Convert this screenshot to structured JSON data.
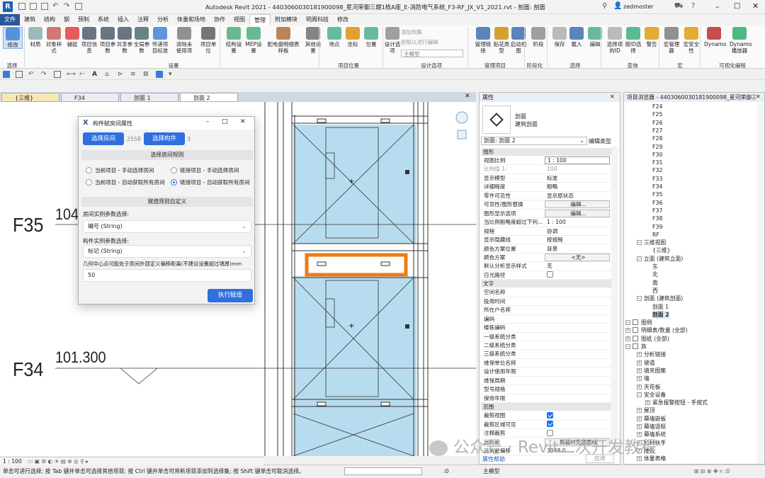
{
  "app": {
    "title": "Autodesk Revit 2021 - 4403060030181900098_星河荣御三期1栋A座_E-消防电气系统_F3-RF_JX_V1_2021.rvt - 剖面: 剖面 2",
    "user": "zedmoster",
    "logo_letter": "R"
  },
  "menu": [
    "文件",
    "建筑",
    "结构",
    "钢",
    "预制",
    "系统",
    "插入",
    "注释",
    "分析",
    "体量和场地",
    "协作",
    "视图",
    "管理",
    "附加模块",
    "明周科技",
    "修改"
  ],
  "ribbon": {
    "buttons": [
      "修改",
      "材质",
      "对象样式",
      "捕捉",
      "项目信息",
      "项目参数",
      "共享参数",
      "全局参数",
      "传递项目标准",
      "清除未使用项",
      "项目单位",
      "结构设置",
      "MEP设置",
      "配电盘明细表样板",
      "其他设置",
      "地点",
      "坐标",
      "位置",
      "设计选项",
      "管理链接",
      "贴花类型",
      "启动视图",
      "阶段",
      "保存",
      "载入",
      "编辑",
      "选择项的ID",
      "按ID选择",
      "警告",
      "宏管理器",
      "宏安全性",
      "Dynamo",
      "Dynamo播放器"
    ],
    "small_items": [
      "添加到集",
      "拾取以进行编辑",
      "主模型"
    ],
    "groups": [
      "选择",
      "设置",
      "项目位置",
      "设计选项",
      "管理项目",
      "阶段化",
      "选择",
      "查询",
      "宏",
      "可视化编程"
    ]
  },
  "view_tabs": [
    "{三维}",
    "F34",
    "剖面 1",
    "剖面 2"
  ],
  "canvas": {
    "levels": [
      {
        "name": "F35",
        "elevation": "104"
      },
      {
        "name": "F34",
        "elevation": "101.300"
      }
    ]
  },
  "dialog": {
    "title": "构件赋房间属性",
    "select_room_btn": "选择房间",
    "room_count": "2558",
    "select_comp_btn": "选择构件",
    "comp_count": "3",
    "section_rules": "选择房间规则",
    "radios": [
      "当前项目 - 手动选择房间",
      "链接项目 - 手动选择房间",
      "当前项目 - 自动获取所有房间",
      "链接项目 - 自动获取所有房间"
    ],
    "section_custom": "赋值规则自定义",
    "room_param_label": "房间实例参数选择:",
    "room_param_value": "编号 (String)",
    "comp_param_label": "构件实例参数选择:",
    "comp_param_value": "标记 (String)",
    "offset_label": "几何中心点可能处于房间外部定义偏移距离(不建议设置超过墙厚)mm",
    "offset_value": "50",
    "execute_btn": "执行赋值"
  },
  "properties": {
    "header": "属性",
    "type_name": "剖面",
    "type_sub": "建筑剖面",
    "selector": "剖面: 剖面 2",
    "edit_type": "编辑类型",
    "sec_graphics": "图形",
    "rows1": [
      {
        "k": "视图比例",
        "v": "1 : 100"
      },
      {
        "k": "比例值 1:",
        "v": "100"
      },
      {
        "k": "显示模型",
        "v": "标准"
      },
      {
        "k": "详细程度",
        "v": "粗略"
      },
      {
        "k": "零件可见性",
        "v": "显示原状态"
      },
      {
        "k": "可见性/图形替换",
        "v": "编辑..."
      },
      {
        "k": "图形显示选项",
        "v": "编辑..."
      },
      {
        "k": "当比例粗略度超过下列...",
        "v": "1 : 100"
      },
      {
        "k": "规程",
        "v": "协调"
      },
      {
        "k": "显示隐藏线",
        "v": "按规程"
      },
      {
        "k": "颜色方案位置",
        "v": "背景"
      },
      {
        "k": "颜色方案",
        "v": "<无>"
      },
      {
        "k": "默认分析显示样式",
        "v": "无"
      },
      {
        "k": "日光路径",
        "v": ""
      }
    ],
    "sec_text": "文字",
    "rows2": [
      "空间名称",
      "投用时间",
      "所在户名称",
      "编码",
      "楼栋编码",
      "一级系统分类",
      "二级系统分类",
      "三级系统分类",
      "维保单位名称",
      "设计使用年限",
      "维保周期",
      "型号规格",
      "保修年限"
    ],
    "sec_extents": "范围",
    "rows3": [
      {
        "k": "裁剪视图",
        "v": ""
      },
      {
        "k": "裁剪区域可见",
        "v": ""
      },
      {
        "k": "注释裁剪",
        "v": ""
      },
      {
        "k": "远剪裁",
        "v": "剪裁时无截面线"
      },
      {
        "k": "远剪裁偏移",
        "v": "3048.0"
      }
    ],
    "help_link": "属性帮助",
    "apply": "应用"
  },
  "browser": {
    "header": "项目浏览器 - 4403060030181900098_星河荣御三",
    "floors": [
      "F24",
      "F25",
      "F26",
      "F27",
      "F28",
      "F29",
      "F30",
      "F31",
      "F32",
      "F33",
      "F34",
      "F35",
      "F36",
      "F37",
      "F38",
      "F39",
      "RF"
    ],
    "tree": [
      {
        "t": "三维视图",
        "lvl": 1,
        "tog": "−"
      },
      {
        "t": "{三维}",
        "lvl": 2
      },
      {
        "t": "立面 (建筑立面)",
        "lvl": 1,
        "tog": "−"
      },
      {
        "t": "东",
        "lvl": 2
      },
      {
        "t": "北",
        "lvl": 2
      },
      {
        "t": "南",
        "lvl": 2
      },
      {
        "t": "西",
        "lvl": 2
      },
      {
        "t": "剖面 (建筑剖面)",
        "lvl": 1,
        "tog": "−"
      },
      {
        "t": "剖面 1",
        "lvl": 2
      },
      {
        "t": "剖面 2",
        "lvl": 2,
        "bold": true
      },
      {
        "t": "图例",
        "lvl": 0,
        "tog": "−"
      },
      {
        "t": "明细表/数量 (全部)",
        "lvl": 0,
        "tog": "+"
      },
      {
        "t": "图纸 (全部)",
        "lvl": 0,
        "tog": "+"
      },
      {
        "t": "族",
        "lvl": 0,
        "tog": "−"
      },
      {
        "t": "分析链接",
        "lvl": 1,
        "tog": "+"
      },
      {
        "t": "坡道",
        "lvl": 1,
        "tog": "+"
      },
      {
        "t": "填充图案",
        "lvl": 1,
        "tog": "+"
      },
      {
        "t": "墙",
        "lvl": 1,
        "tog": "+"
      },
      {
        "t": "天花板",
        "lvl": 1,
        "tog": "+"
      },
      {
        "t": "安全设备",
        "lvl": 1,
        "tog": "−"
      },
      {
        "t": "紧急报警按钮 - 手按式",
        "lvl": 2,
        "tog": "+"
      },
      {
        "t": "屋顶",
        "lvl": 1,
        "tog": "+"
      },
      {
        "t": "幕墙嵌板",
        "lvl": 1,
        "tog": "+"
      },
      {
        "t": "幕墙竖梃",
        "lvl": 1,
        "tog": "+"
      },
      {
        "t": "幕墙系统",
        "lvl": 1,
        "tog": "+"
      },
      {
        "t": "栏杆扶手",
        "lvl": 1,
        "tog": "+"
      },
      {
        "t": "楼板",
        "lvl": 1,
        "tog": "+"
      },
      {
        "t": "体量表格",
        "lvl": 1,
        "tog": "+"
      }
    ]
  },
  "status": {
    "scale": "1 : 100",
    "message": "单击可进行选择; 按 Tab 键并单击可选择其他项目; 按 Ctrl 键并单击可将新项目添加到选择集; 按 Shift 键单击可取消选择。",
    "zero": ":0",
    "model": "主模型"
  },
  "watermark": "公众号 · Revit二次开发教程",
  "colors": {
    "accent": "#2b579a",
    "dialog_btn": "#2f6fde",
    "highlight": "#f07a12",
    "glass": "#b8dcef"
  }
}
